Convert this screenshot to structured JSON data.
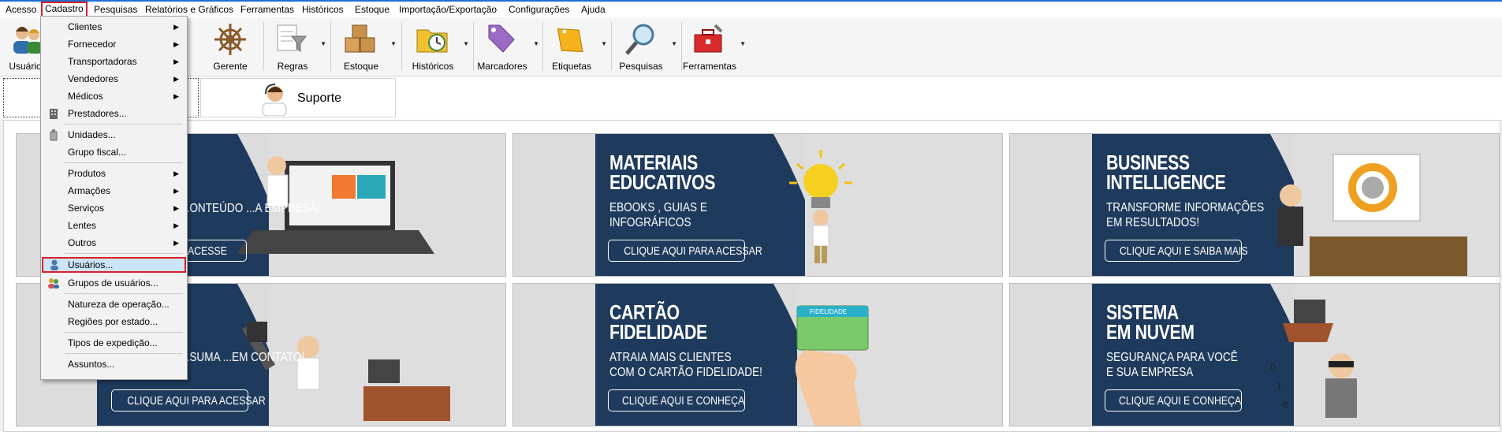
{
  "menubar": {
    "items": [
      "Acesso",
      "Cadastro",
      "Pesquisas",
      "Relatórios e Gráficos",
      "Ferramentas",
      "Históricos",
      "Estoque",
      "Importação/Exportação",
      "Configurações",
      "Ajuda"
    ]
  },
  "toolbar": {
    "buttons": [
      {
        "label": "Usuários",
        "icon": "users-icon"
      },
      {
        "label": "Gerente",
        "icon": "ship-wheel-icon"
      },
      {
        "label": "Regras",
        "icon": "funnel-icon"
      },
      {
        "label": "Estoque",
        "icon": "boxes-icon"
      },
      {
        "label": "Históricos",
        "icon": "folder-clock-icon"
      },
      {
        "label": "Marcadores",
        "icon": "tag-icon"
      },
      {
        "label": "Etiquetas",
        "icon": "label-icon"
      },
      {
        "label": "Pesquisas",
        "icon": "magnifier-icon"
      },
      {
        "label": "Ferramentas",
        "icon": "toolbox-icon"
      }
    ]
  },
  "tabs": {
    "support_label": "Suporte"
  },
  "cadastro_menu": {
    "items": [
      {
        "label": "Clientes",
        "submenu": true
      },
      {
        "label": "Fornecedor",
        "submenu": true
      },
      {
        "label": "Transportadoras",
        "submenu": true
      },
      {
        "label": "Vendedores",
        "submenu": true
      },
      {
        "label": "Médicos",
        "submenu": true
      },
      {
        "label": "Prestadores..."
      },
      {
        "label": "Unidades..."
      },
      {
        "label": "Grupo fiscal..."
      },
      {
        "label": "Produtos",
        "submenu": true
      },
      {
        "label": "Armações",
        "submenu": true
      },
      {
        "label": "Serviços",
        "submenu": true
      },
      {
        "label": "Lentes",
        "submenu": true
      },
      {
        "label": "Outros",
        "submenu": true
      },
      {
        "label": "Usuários...",
        "highlighted": true
      },
      {
        "label": "Grupos de usuários..."
      },
      {
        "label": "Natureza de operação..."
      },
      {
        "label": "Regiões por estado..."
      },
      {
        "label": "Tipos de expedição..."
      },
      {
        "label": "Assuntos..."
      }
    ]
  },
  "banners": [
    {
      "title": "",
      "subtitle": "...ONTEÚDO\n...A EMPRESA!",
      "button": "...E ACESSE"
    },
    {
      "title": "MATERIAIS\nEDUCATIVOS",
      "subtitle": "EBOOKS , GUIAS E\nINFOGRÁFICOS",
      "button": "CLIQUE AQUI PARA ACESSAR"
    },
    {
      "title": "BUSINESS\nINTELLIGENCE",
      "subtitle": "TRANSFORME INFORMAÇÕES\nEM RESULTADOS!",
      "button": "CLIQUE AQUI E SAIBA MAIS"
    },
    {
      "title": "",
      "subtitle": "...SUMA\n...EM CONTATO!",
      "button": "CLIQUE AQUI PARA ACESSAR"
    },
    {
      "title": "CARTÃO\nFIDELIDADE",
      "subtitle": "ATRAIA MAIS CLIENTES\nCOM O CARTÃO FIDELIDADE!",
      "button": "CLIQUE AQUI E CONHEÇA",
      "card_label": "FIDELIDADE"
    },
    {
      "title": "SISTEMA\nEM NUVEM",
      "subtitle": "SEGURANÇA PARA VOCÊ\nE SUA EMPRESA",
      "button": "CLIQUE AQUI E CONHEÇA"
    }
  ],
  "colors": {
    "navy": "#1e3a5c",
    "highlight": "#cce4f7",
    "red_outline": "#d9202a"
  }
}
